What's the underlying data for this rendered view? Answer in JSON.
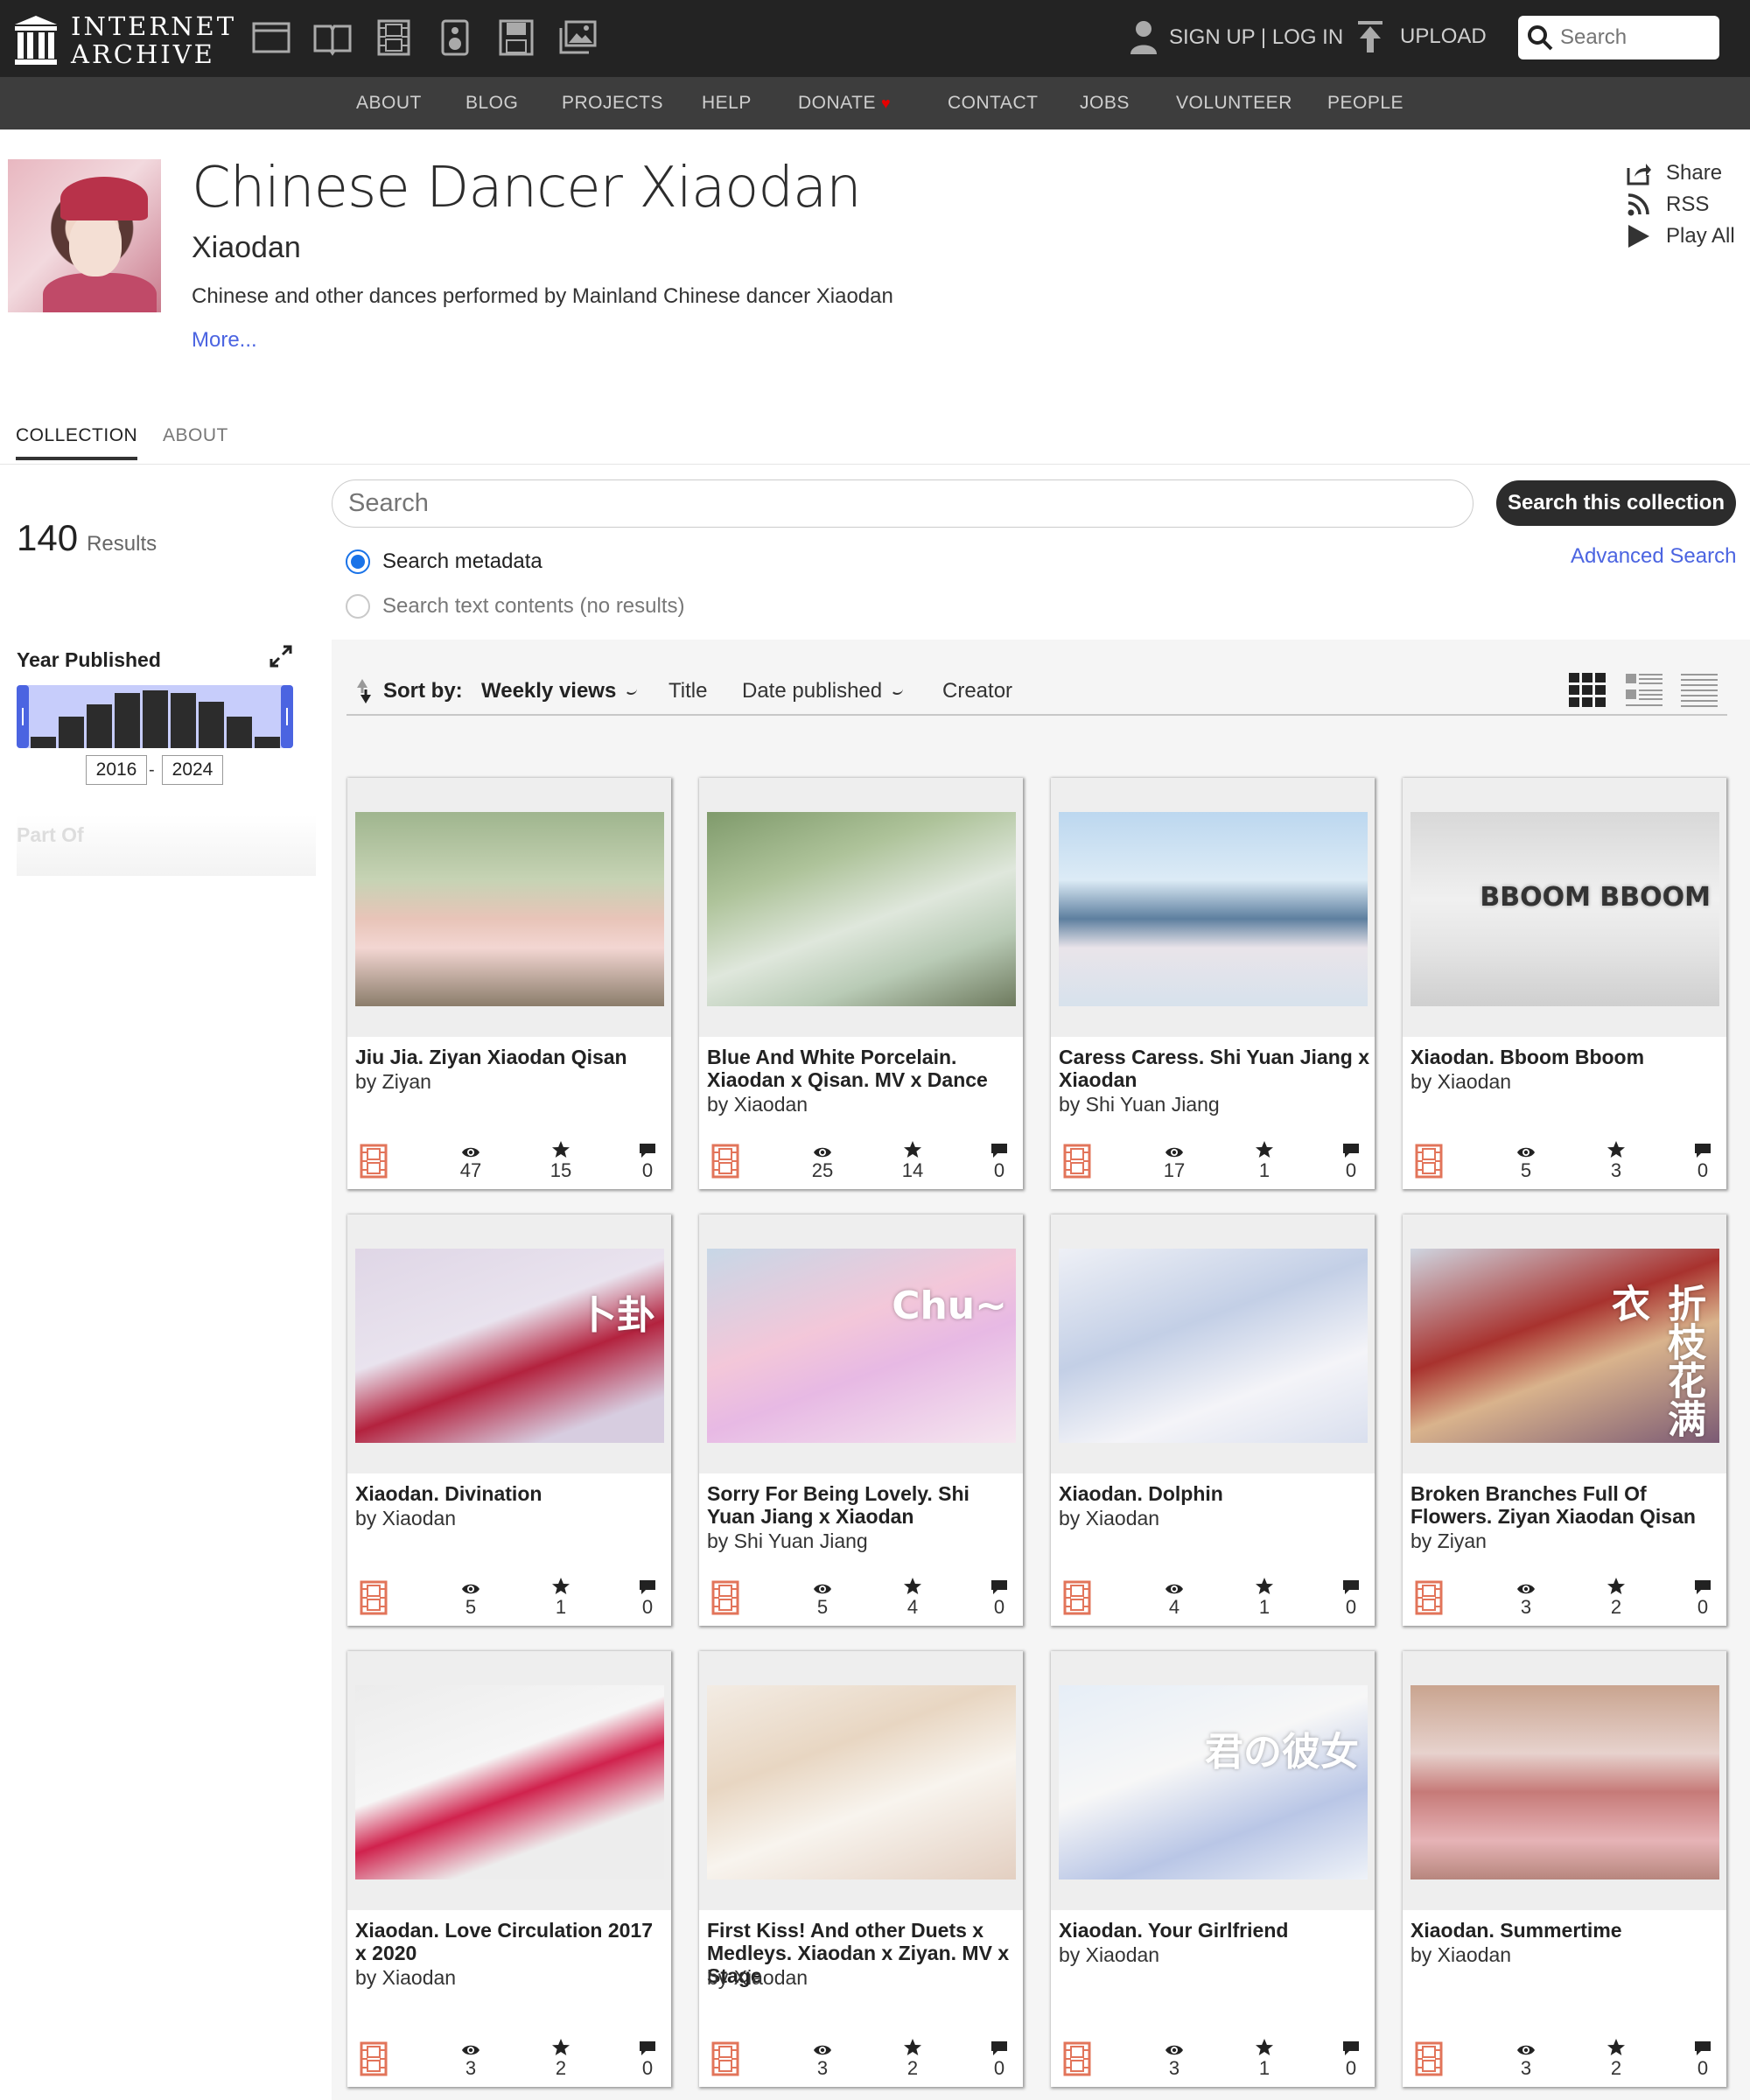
{
  "header": {
    "logo_line1": "INTERNET",
    "logo_line2": "ARCHIVE",
    "media_icons": [
      "web-icon",
      "texts-icon",
      "video-icon",
      "audio-icon",
      "software-icon",
      "images-icon"
    ],
    "signup_label": "SIGN UP | LOG IN",
    "upload_label": "UPLOAD",
    "search_placeholder": "Search"
  },
  "subnav": {
    "items": [
      "ABOUT",
      "BLOG",
      "PROJECTS",
      "HELP",
      "DONATE",
      "CONTACT",
      "JOBS",
      "VOLUNTEER",
      "PEOPLE"
    ]
  },
  "collection": {
    "title": "Chinese Dancer Xiaodan",
    "creator": "Xiaodan",
    "description": "Chinese and other dances performed by Mainland Chinese dancer Xiaodan",
    "more": "More...",
    "actions": [
      "Share",
      "RSS",
      "Play All"
    ]
  },
  "tabs": [
    "COLLECTION",
    "ABOUT"
  ],
  "sidebar": {
    "results_count": "140",
    "results_label": "Results",
    "year_title": "Year Published",
    "year_from": "2016",
    "year_to": "2024",
    "year_hist_levels": [
      0.2,
      0.55,
      0.75,
      0.95,
      1.0,
      0.95,
      0.8,
      0.55,
      0.2
    ],
    "part_of": "Part Of"
  },
  "search": {
    "placeholder": "Search",
    "button": "Search this collection",
    "advanced": "Advanced Search",
    "radio_metadata": "Search metadata",
    "radio_text": "Search text contents (no results)"
  },
  "sort": {
    "label": "Sort by:",
    "weekly": "Weekly views",
    "title": "Title",
    "date": "Date published",
    "creator": "Creator"
  },
  "colors": {
    "accent": "#4b64e1",
    "topbar": "#232323",
    "subnav": "#3d3d3d",
    "film_icon": "#e2745a",
    "heart": "#e60000"
  },
  "items": [
    {
      "title": "Jiu Jia. Ziyan Xiaodan Qisan",
      "by": "by Ziyan",
      "views": "47",
      "favs": "15",
      "reviews": "0"
    },
    {
      "title": "Blue And White Porcelain. Xiaodan x Qisan. MV x Dance",
      "by": "by Xiaodan",
      "views": "25",
      "favs": "14",
      "reviews": "0"
    },
    {
      "title": "Caress Caress. Shi Yuan Jiang x Xiaodan",
      "by": "by Shi Yuan Jiang",
      "views": "17",
      "favs": "1",
      "reviews": "0"
    },
    {
      "title": "Xiaodan. Bboom Bboom",
      "by": "by Xiaodan",
      "views": "5",
      "favs": "3",
      "reviews": "0",
      "thumb_text": "BBOOM BBOOM"
    },
    {
      "title": "Xiaodan. Divination",
      "by": "by Xiaodan",
      "views": "5",
      "favs": "1",
      "reviews": "0",
      "thumb_text": "卜卦"
    },
    {
      "title": "Sorry For Being Lovely. Shi Yuan Jiang x Xiaodan",
      "by": "by Shi Yuan Jiang",
      "views": "5",
      "favs": "4",
      "reviews": "0",
      "thumb_text": "Chu~"
    },
    {
      "title": "Xiaodan. Dolphin",
      "by": "by Xiaodan",
      "views": "4",
      "favs": "1",
      "reviews": "0"
    },
    {
      "title": "Broken Branches Full Of Flowers. Ziyan Xiaodan Qisan",
      "by": "by Ziyan",
      "views": "3",
      "favs": "2",
      "reviews": "0",
      "thumb_text": "折枝花满衣"
    },
    {
      "title": "Xiaodan. Love Circulation 2017 x 2020",
      "by": "by Xiaodan",
      "views": "3",
      "favs": "2",
      "reviews": "0"
    },
    {
      "title": "First Kiss! And other Duets x Medleys. Xiaodan x Ziyan. MV x Stage",
      "by": "by Xiaodan",
      "views": "3",
      "favs": "2",
      "reviews": "0"
    },
    {
      "title": "Xiaodan. Your Girlfriend",
      "by": "by Xiaodan",
      "views": "3",
      "favs": "1",
      "reviews": "0",
      "thumb_text": "君の彼女"
    },
    {
      "title": "Xiaodan. Summertime",
      "by": "by Xiaodan",
      "views": "3",
      "favs": "2",
      "reviews": "0"
    }
  ]
}
